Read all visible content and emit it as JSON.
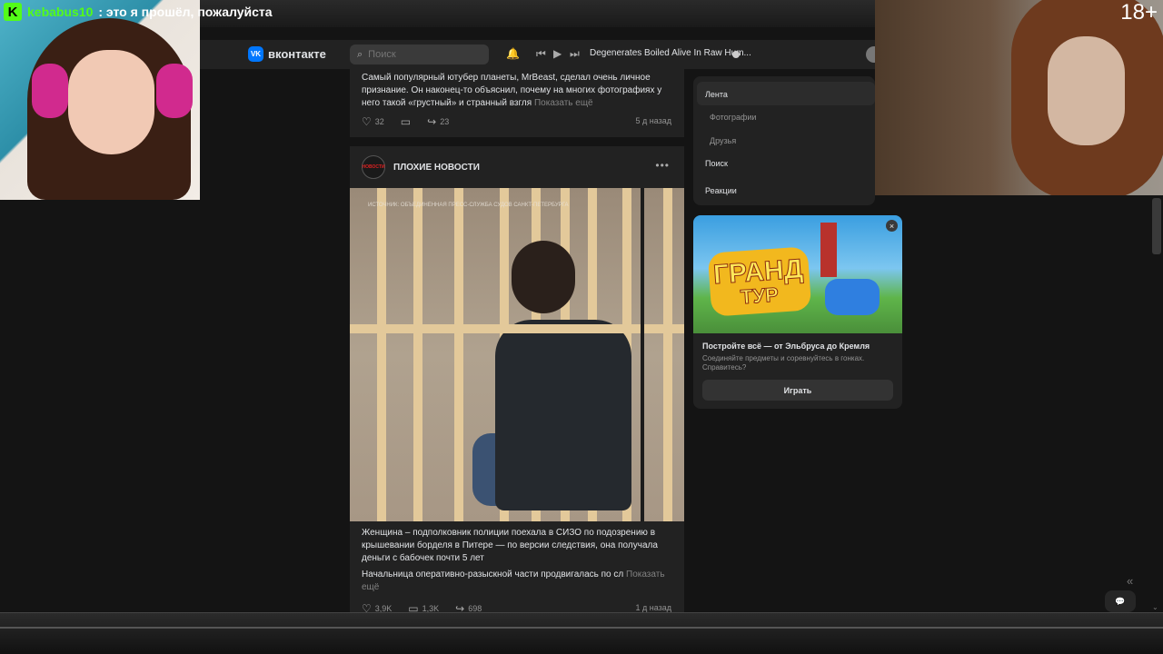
{
  "stream": {
    "chat_username": "kebabus10",
    "chat_message": ": это я прошёл, пожалуйста",
    "kick_logo": "K",
    "age_rating": "18+"
  },
  "header": {
    "logo_mark": "VK",
    "logo_text": "вконтакте",
    "search_placeholder": "Поиск",
    "now_playing": "Degenerates Boiled Alive In Raw Hum..."
  },
  "feed": {
    "post1": {
      "text": "Самый популярный ютубер планеты, MrBeast, сделал очень личное признание. Он наконец-то объяснил, почему на многих фотографиях у него такой «грустный» и странный взгля",
      "show_more": "Показать ещё",
      "likes": "32",
      "shares": "23",
      "date": "5 д назад"
    },
    "post2": {
      "group_avatar_text": "НОВОСТИ",
      "group_name": "ПЛОХИЕ НОВОСТИ",
      "more": "•••",
      "photo_source": "ИСТОЧНИК: ОБЪЕДИНЁННАЯ ПРЕСС-СЛУЖБА СУДОВ САНКТ-ПЕТЕРБУРГА",
      "title": "Женщина – подполковник полиции поехала в СИЗО по подозрению в крышевании борделя в Питере — по версии следствия, она получала деньги с бабочек почти 5 лет",
      "subtitle": "Начальница оперативно-разыскной части продвигалась по сл",
      "show_more": "Показать ещё",
      "likes": "3,9K",
      "comments": "1,3K",
      "shares": "698",
      "date": "1 д назад"
    }
  },
  "menu": {
    "items": [
      "Лента",
      "Фотографии",
      "Друзья",
      "Поиск",
      "Реакции"
    ]
  },
  "ad": {
    "logo_line1": "ГРАНД",
    "logo_line2": "ТУР",
    "title": "Постройте всё — от Эльбруса до Кремля",
    "description": "Соединяйте предметы и соревнуйтесь в гонках. Справитесь?",
    "button": "Играть",
    "close": "×"
  },
  "icons": {
    "search": "⌕",
    "bell": "🔔",
    "prev": "⏮",
    "play": "▶",
    "next": "⏭",
    "like": "♡",
    "comment": "▭",
    "share": "↪",
    "collapse": "«",
    "chat": "💬",
    "scroll_down": "⌄"
  },
  "colors": {
    "kick_green": "#53fc18",
    "vk_blue": "#0077ff",
    "panel_bg": "#222222",
    "page_bg": "#141414"
  }
}
